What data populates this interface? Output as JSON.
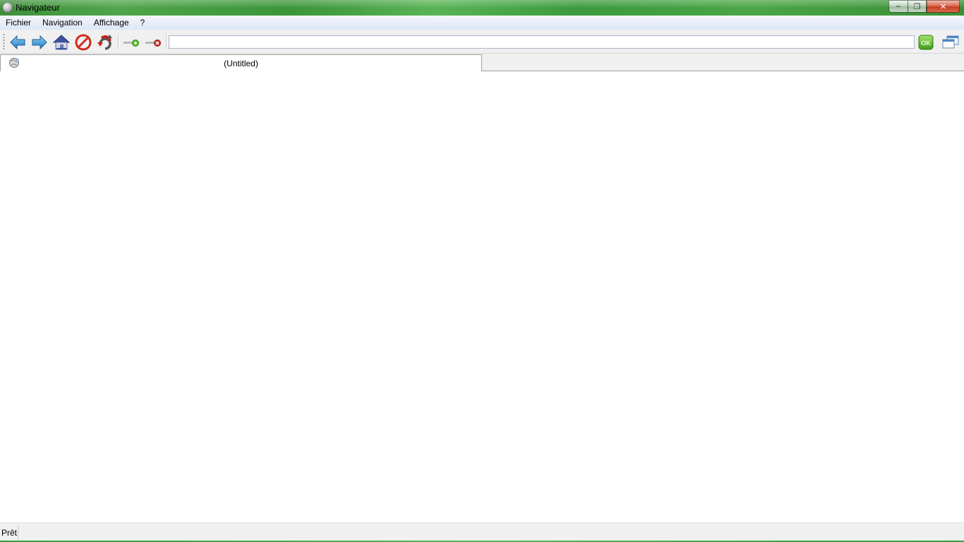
{
  "window": {
    "title": "Navigateur",
    "controls": {
      "minimize": "–",
      "maximize": "❐",
      "close": "✕"
    }
  },
  "menu": {
    "items": [
      "Fichier",
      "Navigation",
      "Affichage",
      "?"
    ]
  },
  "toolbar": {
    "buttons": [
      "back-arrow-icon",
      "forward-arrow-icon",
      "home-icon",
      "stop-icon",
      "refresh-icon",
      "add-icon",
      "remove-icon"
    ],
    "url": {
      "value": "",
      "placeholder": ""
    },
    "go_label": "OK"
  },
  "tabs": [
    {
      "label": "(Untitled)"
    }
  ],
  "status": {
    "text": "Prêt"
  },
  "colors": {
    "titlebar_green": "#3d8f3a",
    "stop_red": "#d42a1e",
    "arrow_blue": "#3a8fd0",
    "go_green": "#5cbf2a"
  }
}
